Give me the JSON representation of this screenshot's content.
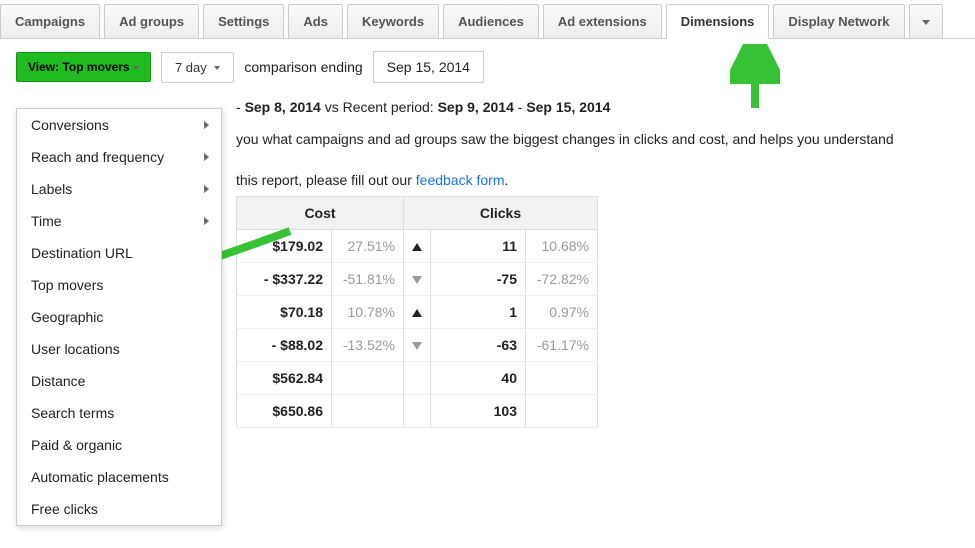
{
  "tabs": [
    "Campaigns",
    "Ad groups",
    "Settings",
    "Ads",
    "Keywords",
    "Audiences",
    "Ad extensions",
    "Dimensions",
    "Display Network"
  ],
  "active_tab_index": 7,
  "toolbar": {
    "view_label": "View: Top movers",
    "range_label": "7 day",
    "comparison_label": "comparison ending",
    "date_text": "Sep 15, 2014"
  },
  "periods": {
    "prefix": "- ",
    "prev_end": "Sep 8, 2014",
    "mid": " vs Recent period: ",
    "recent_start": "Sep 9, 2014",
    "sep": " - ",
    "recent_end": "Sep 15, 2014"
  },
  "description": "you what campaigns and ad groups saw the biggest changes in clicks and cost, and helps you understand",
  "feedback_prefix": "this report, please fill out our ",
  "feedback_link": "feedback form",
  "feedback_suffix": ".",
  "table": {
    "header_cost": "Cost",
    "header_clicks": "Clicks",
    "rows": [
      {
        "cost": "$179.02",
        "cost_pct": "27.51%",
        "clicks_dir": "up",
        "clicks": "11",
        "clicks_pct": "10.68%"
      },
      {
        "cost": "- $337.22",
        "cost_pct": "-51.81%",
        "clicks_dir": "down",
        "clicks": "-75",
        "clicks_pct": "-72.82%"
      },
      {
        "cost": "$70.18",
        "cost_pct": "10.78%",
        "clicks_dir": "up",
        "clicks": "1",
        "clicks_pct": "0.97%"
      },
      {
        "cost": "- $88.02",
        "cost_pct": "-13.52%",
        "clicks_dir": "down",
        "clicks": "-63",
        "clicks_pct": "-61.17%"
      },
      {
        "cost": "$562.84",
        "cost_pct": "",
        "clicks_dir": "",
        "clicks": "40",
        "clicks_pct": ""
      },
      {
        "cost": "$650.86",
        "cost_pct": "",
        "clicks_dir": "",
        "clicks": "103",
        "clicks_pct": ""
      }
    ]
  },
  "dropdown": [
    {
      "label": "Conversions",
      "submenu": true
    },
    {
      "label": "Reach and frequency",
      "submenu": true
    },
    {
      "label": "Labels",
      "submenu": true
    },
    {
      "label": "Time",
      "submenu": true
    },
    {
      "label": "Destination URL",
      "submenu": false
    },
    {
      "label": "Top movers",
      "submenu": false
    },
    {
      "label": "Geographic",
      "submenu": false
    },
    {
      "label": "User locations",
      "submenu": false
    },
    {
      "label": "Distance",
      "submenu": false
    },
    {
      "label": "Search terms",
      "submenu": false
    },
    {
      "label": "Paid & organic",
      "submenu": false
    },
    {
      "label": "Automatic placements",
      "submenu": false
    },
    {
      "label": "Free clicks",
      "submenu": false
    }
  ],
  "colors": {
    "accent_green": "#1fbb1f",
    "arrow_green": "#35c335"
  }
}
